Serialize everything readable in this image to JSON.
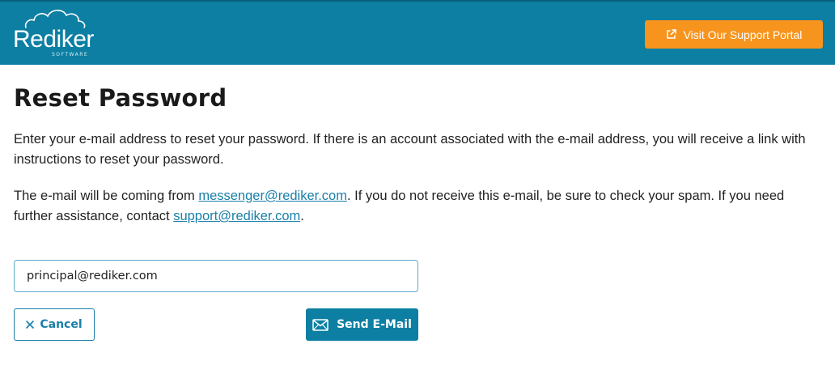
{
  "header": {
    "logo_text": "Rediker",
    "logo_subtext": "SOFTWARE",
    "support_button_label": "Visit Our Support Portal",
    "support_icon": "external-link-icon"
  },
  "main": {
    "title": "Reset Password",
    "paragraph1": "Enter your e-mail address to reset your password. If there is an account associated with the e-mail address, you will receive a link with instructions to reset your password.",
    "paragraph2": {
      "part1": "The e-mail will be coming from ",
      "link1": "messenger@rediker.com",
      "part2": ". If you do not receive this e-mail, be sure to check your spam. If you need further assistance, contact ",
      "link2": "support@rediker.com",
      "part3": "."
    },
    "email_input": {
      "value": "principal@rediker.com",
      "placeholder": ""
    },
    "cancel_button_label": "Cancel",
    "cancel_icon": "close-icon",
    "send_button_label": "Send E-Mail",
    "send_icon": "envelope-icon"
  },
  "colors": {
    "header_bg": "#0c7fa3",
    "support_button_bg": "#f7941d",
    "primary": "#0c7fa3",
    "link": "#1a7fa8"
  }
}
